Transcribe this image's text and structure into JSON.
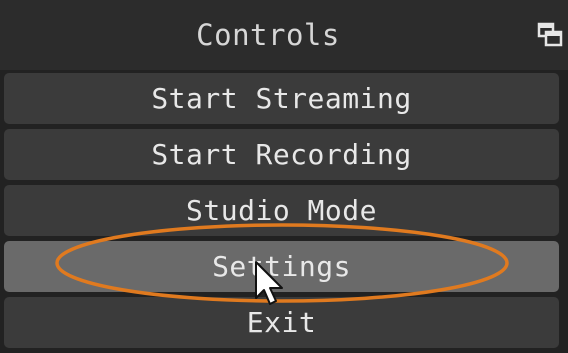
{
  "panel": {
    "title": "Controls",
    "float_icon": "undock-icon"
  },
  "buttons": [
    {
      "label": "Start Streaming"
    },
    {
      "label": "Start Recording"
    },
    {
      "label": "Studio Mode"
    },
    {
      "label": "Settings",
      "state": "hover"
    },
    {
      "label": "Exit"
    }
  ],
  "annotation": {
    "highlight_color": "#e07a1f",
    "target": "Settings"
  },
  "colors": {
    "panel_bg": "#222222",
    "titlebar_bg": "#2c2c2c",
    "button_bg": "#3b3b3b",
    "button_hover_bg": "#6a6a6a",
    "text": "#e8e8e8"
  }
}
